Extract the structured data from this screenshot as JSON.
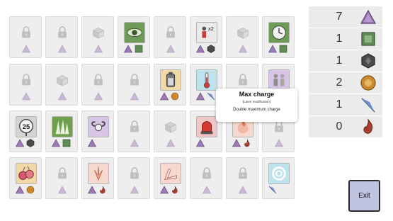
{
  "tooltip": {
    "title": "Max charge",
    "subtitle": "(Laser modification)",
    "description": "Double maximum charge"
  },
  "resources": [
    {
      "name": "purple-crystal",
      "count": "7",
      "color": "#9d7ab7"
    },
    {
      "name": "green-cube",
      "count": "1",
      "color": "#5f8b55"
    },
    {
      "name": "dark-hexagon",
      "count": "1",
      "color": "#4b4b4b"
    },
    {
      "name": "orange-orb",
      "count": "2",
      "color": "#cc8a2f"
    },
    {
      "name": "blue-shard",
      "count": "1",
      "color": "#3d5fa5"
    },
    {
      "name": "red-flame",
      "count": "0",
      "color": "#a84030"
    }
  ],
  "exit_label": "Exit",
  "grid": [
    [
      {
        "type": "locked",
        "costs": [
          "purple"
        ]
      },
      {
        "type": "locked",
        "costs": [
          "purple"
        ]
      },
      {
        "type": "box",
        "costs": [
          "purple"
        ]
      },
      {
        "type": "open",
        "icon": "green-eye-icon",
        "bg": "#6f9a58",
        "costs": [
          "purple",
          "green"
        ]
      },
      {
        "type": "locked",
        "costs": [
          "purple"
        ]
      },
      {
        "type": "open",
        "icon": "double-target-icon",
        "bg": "#e9e9e9",
        "label": "x2",
        "costs": [
          "purple",
          "dark"
        ]
      },
      {
        "type": "box",
        "costs": [
          "purple"
        ]
      },
      {
        "type": "open",
        "icon": "clock-icon",
        "bg": "#6e9c57",
        "costs": [
          "purple",
          "green"
        ]
      }
    ],
    [
      {
        "type": "locked",
        "costs": [
          "purple"
        ]
      },
      {
        "type": "box",
        "costs": [
          "purple"
        ]
      },
      {
        "type": "locked",
        "costs": [
          "purple"
        ]
      },
      {
        "type": "locked",
        "costs": [
          "purple"
        ]
      },
      {
        "type": "open",
        "icon": "battery-icon",
        "bg": "#f0d8a8",
        "costs": [
          "purple",
          "orange"
        ]
      },
      {
        "type": "open",
        "icon": "thermometer-icon",
        "bg": "#bfe3ec",
        "costs": [
          "purple",
          "blue"
        ]
      },
      {
        "type": "locked",
        "costs": [
          "purple"
        ]
      },
      {
        "type": "open",
        "icon": "figures-icon",
        "bg": "#d8c5e6",
        "costs": [
          "purple"
        ]
      }
    ],
    [
      {
        "type": "open",
        "icon": "speed-25-icon",
        "bg": "#d4d4d4",
        "label": "25",
        "costs": [
          "purple",
          "dark"
        ]
      },
      {
        "type": "open",
        "icon": "green-spikes-icon",
        "bg": "#70a04f",
        "costs": [
          "purple",
          "green"
        ]
      },
      {
        "type": "open",
        "icon": "ram-skull-icon",
        "bg": "#d8c5e6",
        "costs": [
          "purple"
        ]
      },
      {
        "type": "locked",
        "costs": [
          "purple"
        ]
      },
      {
        "type": "box",
        "costs": [
          "purple"
        ]
      },
      {
        "type": "open",
        "icon": "siren-icon",
        "bg": "#f1c6c6",
        "costs": [
          "purple"
        ]
      },
      {
        "type": "open",
        "icon": "fire-orb-icon",
        "bg": "#f6d8cf",
        "costs": [
          "purple",
          "red"
        ]
      },
      {
        "type": "locked",
        "costs": [
          "purple"
        ]
      }
    ],
    [
      {
        "type": "open",
        "icon": "twin-orbs-icon",
        "bg": "#f3d7a7",
        "costs": [
          "purple",
          "orange"
        ]
      },
      {
        "type": "locked",
        "costs": [
          "purple"
        ]
      },
      {
        "type": "open",
        "icon": "splash-icon",
        "bg": "#f6d8cf",
        "costs": [
          "purple",
          "red"
        ]
      },
      {
        "type": "locked",
        "costs": [
          "purple"
        ]
      },
      {
        "type": "open",
        "icon": "boomerang-icon",
        "bg": "#f6d8cf",
        "costs": [
          "purple",
          "red"
        ]
      },
      {
        "type": "locked",
        "costs": [
          "purple"
        ]
      },
      {
        "type": "locked",
        "costs": [
          "purple"
        ]
      },
      {
        "type": "open",
        "icon": "swirl-icon",
        "bg": "#bde4ee",
        "costs": [
          "blue"
        ]
      }
    ]
  ]
}
